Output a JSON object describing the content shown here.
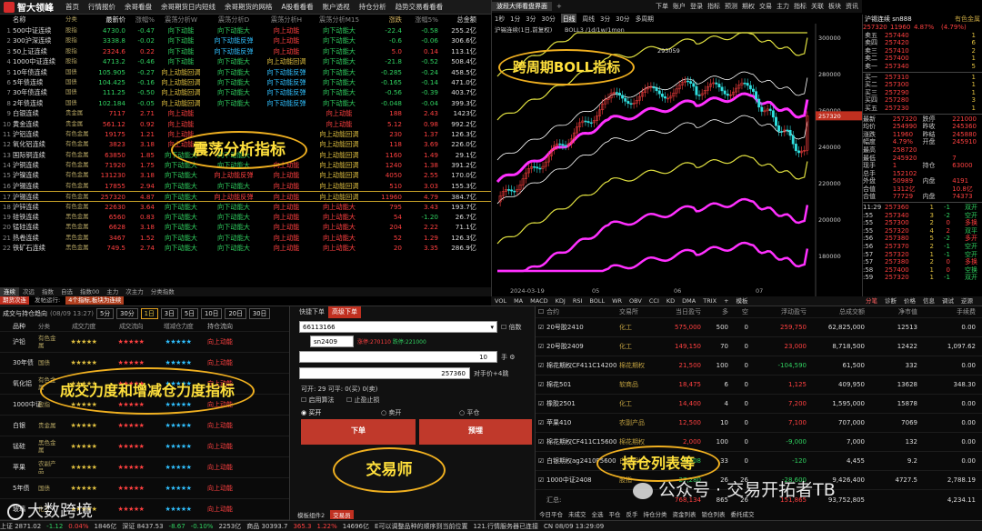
{
  "app": {
    "name": "智大领峰",
    "menu": [
      "首页",
      "行情报价",
      "余哥看盘",
      "余哥期货日内短线",
      "余哥期货的网格",
      "A股看看看",
      "账户透视",
      "持仓分析",
      "趋势交易看看看"
    ]
  },
  "quote": {
    "headers": [
      "名称",
      "分类",
      "最新价",
      "涨幅%",
      "震荡分析W",
      "震荡分析D",
      "震荡分析H",
      "震荡分析M15",
      "涨跌",
      "涨幅5%",
      "总金额"
    ],
    "rows": [
      {
        "n": "1",
        "name": "500中证连续",
        "cat": "股指",
        "price": "4730.0",
        "chg": "-0.47",
        "w": "向下动能",
        "d": "向下动能大",
        "h": "向上动能",
        "m": "向下动能大",
        "diff": "-22.4",
        "c5": "-0.58",
        "amt": "255.2亿",
        "dir": "down"
      },
      {
        "n": "2",
        "name": "300沪深连续",
        "cat": "股指",
        "price": "3338.8",
        "chg": "-0.02",
        "w": "向下动能",
        "d": "向下动能反弹",
        "h": "向上动能",
        "m": "向下动能大",
        "diff": "-0.6",
        "c5": "-0.06",
        "amt": "306.6亿",
        "dir": "down"
      },
      {
        "n": "3",
        "name": "50上证连续",
        "cat": "股指",
        "price": "2324.6",
        "chg": "0.22",
        "w": "向下动能",
        "d": "向下动能反弹",
        "h": "向上动能",
        "m": "向下动能大",
        "diff": "5.0",
        "c5": "0.14",
        "amt": "113.1亿",
        "dir": "up"
      },
      {
        "n": "4",
        "name": "1000中证连续",
        "cat": "股指",
        "price": "4713.2",
        "chg": "-0.46",
        "w": "向下动能",
        "d": "向下动能大",
        "h": "向上动能回调",
        "m": "向下动能大",
        "diff": "-21.8",
        "c5": "-0.52",
        "amt": "508.4亿",
        "dir": "down"
      },
      {
        "n": "5",
        "name": "10年债连续",
        "cat": "国债",
        "price": "105.905",
        "chg": "-0.27",
        "w": "向上动能回调",
        "d": "向下动能大",
        "h": "向下动能反弹",
        "m": "向下动能大",
        "diff": "-0.285",
        "c5": "-0.24",
        "amt": "458.5亿",
        "dir": "down"
      },
      {
        "n": "6",
        "name": "5年债连续",
        "cat": "国债",
        "price": "104.425",
        "chg": "-0.16",
        "w": "向上动能回调",
        "d": "向下动能大",
        "h": "向下动能反弹",
        "m": "向下动能大",
        "diff": "-0.165",
        "c5": "-0.14",
        "amt": "471.0亿",
        "dir": "down"
      },
      {
        "n": "7",
        "name": "30年债连续",
        "cat": "国债",
        "price": "111.25",
        "chg": "-0.50",
        "w": "向上动能回调",
        "d": "向下动能大",
        "h": "向下动能反弹",
        "m": "向下动能大",
        "diff": "-0.56",
        "c5": "-0.39",
        "amt": "403.7亿",
        "dir": "down"
      },
      {
        "n": "8",
        "name": "2年债连续",
        "cat": "国债",
        "price": "102.184",
        "chg": "-0.05",
        "w": "向上动能回调",
        "d": "向下动能大",
        "h": "向下动能反弹",
        "m": "向下动能大",
        "diff": "-0.048",
        "c5": "-0.04",
        "amt": "399.3亿",
        "dir": "down"
      },
      {
        "n": "9",
        "name": "白银连续",
        "cat": "贵金属",
        "price": "7117",
        "chg": "2.71",
        "w": "向上动能",
        "d": "",
        "h": "",
        "m": "向上动能",
        "diff": "188",
        "c5": "2.43",
        "amt": "1423亿",
        "dir": "up"
      },
      {
        "n": "10",
        "name": "黄金连续",
        "cat": "贵金属",
        "price": "561.12",
        "chg": "0.92",
        "w": "向上动能",
        "d": "",
        "h": "",
        "m": "向上动能",
        "diff": "5.12",
        "c5": "0.98",
        "amt": "992.2亿",
        "dir": "up"
      },
      {
        "n": "11",
        "name": "沪铝连续",
        "cat": "有色金属",
        "price": "19175",
        "chg": "1.21",
        "w": "向上动能",
        "d": "",
        "h": "",
        "m": "向上动能回调",
        "diff": "230",
        "c5": "1.37",
        "amt": "126.3亿",
        "dir": "up"
      },
      {
        "n": "12",
        "name": "氧化铝连续",
        "cat": "有色金属",
        "price": "3823",
        "chg": "3.18",
        "w": "向上动能",
        "d": "",
        "h": "",
        "m": "向上动能回调",
        "diff": "118",
        "c5": "3.69",
        "amt": "226.0亿",
        "dir": "up"
      },
      {
        "n": "13",
        "name": "国际铜连续",
        "cat": "有色金属",
        "price": "63850",
        "chg": "1.85",
        "w": "向下动能大",
        "d": "向下动能大",
        "h": "",
        "m": "向上动能回调",
        "diff": "1160",
        "c5": "1.49",
        "amt": "29.1亿",
        "dir": "up"
      },
      {
        "n": "14",
        "name": "沪铜连续",
        "cat": "有色金属",
        "price": "71920",
        "chg": "1.75",
        "w": "向下动能大",
        "d": "向下动能大",
        "h": "向上动能",
        "m": "向上动能回调",
        "diff": "1240",
        "c5": "1.38",
        "amt": "391.2亿",
        "dir": "up"
      },
      {
        "n": "15",
        "name": "沪镍连续",
        "cat": "有色金属",
        "price": "131230",
        "chg": "3.18",
        "w": "向下动能大",
        "d": "向上动能反弹",
        "h": "向上动能",
        "m": "向上动能回调",
        "diff": "4050",
        "c5": "2.55",
        "amt": "170.0亿",
        "dir": "up"
      },
      {
        "n": "16",
        "name": "沪锡连续",
        "cat": "有色金属",
        "price": "17855",
        "chg": "2.94",
        "w": "向下动能大",
        "d": "向下动能大",
        "h": "向上动能",
        "m": "向上动能回调",
        "diff": "510",
        "c5": "3.03",
        "amt": "155.3亿",
        "dir": "up"
      },
      {
        "n": "17",
        "name": "沪锡连续",
        "cat": "有色金属",
        "price": "257320",
        "chg": "4.87",
        "w": "向下动能大",
        "d": "向上动能反弹",
        "h": "向上动能",
        "m": "向上动能回调",
        "diff": "11960",
        "c5": "4.79",
        "amt": "384.7亿",
        "dir": "up"
      },
      {
        "n": "18",
        "name": "沪锌连续",
        "cat": "有色金属",
        "price": "22630",
        "chg": "3.64",
        "w": "向下动能大",
        "d": "向下动能大",
        "h": "向上动能",
        "m": "向上动能大",
        "diff": "795",
        "c5": "3.43",
        "amt": "193.7亿",
        "dir": "up"
      },
      {
        "n": "19",
        "name": "硅铁连续",
        "cat": "黑色金属",
        "price": "6560",
        "chg": "0.83",
        "w": "向下动能大",
        "d": "向下动能大",
        "h": "向上动能",
        "m": "向上动能大",
        "diff": "54",
        "c5": "-1.20",
        "amt": "26.7亿",
        "dir": "up"
      },
      {
        "n": "20",
        "name": "锰硅连续",
        "cat": "黑色金属",
        "price": "6628",
        "chg": "3.18",
        "w": "向下动能大",
        "d": "向下动能大",
        "h": "向上动能",
        "m": "向上动能大",
        "diff": "204",
        "c5": "2.22",
        "amt": "71.1亿",
        "dir": "up"
      },
      {
        "n": "21",
        "name": "热卷连续",
        "cat": "黑色金属",
        "price": "3467",
        "chg": "1.52",
        "w": "向下动能大",
        "d": "向下动能大",
        "h": "向上动能",
        "m": "向上动能大",
        "diff": "52",
        "c5": "1.29",
        "amt": "126.3亿",
        "dir": "up"
      },
      {
        "n": "22",
        "name": "铁矿石连续",
        "cat": "黑色金属",
        "price": "749.5",
        "chg": "2.74",
        "w": "向下动能大",
        "d": "向下动能大",
        "h": "向上动能",
        "m": "向上动能大",
        "diff": "20",
        "c5": "3.35",
        "amt": "286.9亿",
        "dir": "up"
      }
    ],
    "tabs": [
      "连续",
      "次远",
      "指数",
      "自选",
      "指数00",
      "主力",
      "次主力",
      "分类指数"
    ],
    "status": {
      "badge1": "期货次连",
      "mid": "发帖运行:",
      "badge2": "4个指标,板块为连续"
    }
  },
  "chart": {
    "title": "波段大师看盘界面",
    "toolbar": [
      "下单",
      "账户",
      "登录",
      "指标",
      "预测",
      "期权",
      "交易",
      "主力",
      "指标",
      "关联",
      "板块",
      "资讯"
    ],
    "periods": [
      "1秒",
      "1分",
      "3分",
      "30分",
      "日线",
      "周线",
      "3分",
      "30分",
      "多周期"
    ],
    "active_period": "日线",
    "legend": "沪锡连续(1日,前复权)",
    "boll_label": "BOLL3 /1d/1w/1mon",
    "high_label": "293059",
    "axis_labels": [
      "300000",
      "280000",
      "260000",
      "240000",
      "220000",
      "200000",
      "180000"
    ],
    "date_labels": [
      "2024-03-19",
      "05",
      "06",
      "07"
    ],
    "indicators": [
      "VOL",
      "MA",
      "MACD",
      "KDJ",
      "RSI",
      "BOLL",
      "WR",
      "OBV",
      "CCI",
      "KD",
      "DMA",
      "TRIX",
      "+",
      "模板"
    ]
  },
  "order_book": {
    "title": "沪锡连续 sn888",
    "title_right": "有色金属",
    "quote_line": {
      "price": "257320",
      "chg": "11960",
      "pct": "4.87%",
      "pct2": "(4.79%)"
    },
    "asks": [
      [
        "卖五",
        "257440",
        "1"
      ],
      [
        "卖四",
        "257420",
        "6"
      ],
      [
        "卖三",
        "257410",
        "2"
      ],
      [
        "卖二",
        "257400",
        "1"
      ],
      [
        "卖一",
        "257340",
        "5"
      ]
    ],
    "bids": [
      [
        "买一",
        "257310",
        "1"
      ],
      [
        "买二",
        "257300",
        "1"
      ],
      [
        "买三",
        "257290",
        "1"
      ],
      [
        "买四",
        "257280",
        "3"
      ],
      [
        "买五",
        "257230",
        "1"
      ]
    ],
    "stats": [
      [
        "最新",
        "257320",
        "跌停",
        "221000"
      ],
      [
        "均价",
        "254990",
        "昨收",
        "245360"
      ],
      [
        "涨跌",
        "11960",
        "昨结",
        "245880"
      ],
      [
        "幅度",
        "4.79%",
        "开盘",
        "245910"
      ],
      [
        "最高",
        "258720",
        "",
        ""
      ],
      [
        "最低",
        "245920",
        "",
        "7"
      ],
      [
        "现手",
        "1",
        "持仓",
        "63000"
      ],
      [
        "总手",
        "152102",
        "",
        ""
      ],
      [
        "外盘",
        "50989",
        "内盘",
        "4191"
      ],
      [
        "合值",
        "1312亿",
        "",
        "10.8亿"
      ],
      [
        "合值",
        "77729",
        "内盘",
        "74373"
      ]
    ],
    "ticks": [
      [
        "11:29",
        "257360",
        "1",
        "-1",
        "双开"
      ],
      [
        ":55",
        "257340",
        "3",
        "-2",
        "空开"
      ],
      [
        ":55",
        "257300",
        "2",
        "0",
        "多换"
      ],
      [
        ":55",
        "257320",
        "4",
        "2",
        "双平"
      ],
      [
        ":56",
        "257380",
        "5",
        "-2",
        "多开"
      ],
      [
        ":56",
        "257370",
        "2",
        "-1",
        "空开"
      ],
      [
        ":57",
        "257320",
        "1",
        "-1",
        "空开"
      ],
      [
        ":57",
        "257380",
        "2",
        "0",
        "多换"
      ],
      [
        ":58",
        "257400",
        "1",
        "0",
        "空换"
      ],
      [
        ":59",
        "257320",
        "1",
        "-1",
        "双开"
      ]
    ],
    "tabs": [
      "分笔",
      "诊断",
      "价格",
      "信息",
      "调试",
      "逆源"
    ]
  },
  "ranking": {
    "title": "成交与持仓趋向",
    "date": "(08/09 13:27)",
    "periods": [
      "5分",
      "30分",
      "1日",
      "3日",
      "5日",
      "10日",
      "20日",
      "30日"
    ],
    "active": "1日",
    "headers": [
      "品种",
      "分类",
      "成交力度",
      "成交流向",
      "增减仓力度",
      "持仓流向"
    ],
    "rows": [
      {
        "name": "沪铅",
        "cat": "有色金属",
        "a": "★★★★★",
        "b": "★★★★★",
        "c": "★★★★★",
        "d": "向上动能"
      },
      {
        "name": "30年债",
        "cat": "国债",
        "a": "★★★★★",
        "b": "★★★★★",
        "c": "★★★★★",
        "d": "向上动能"
      },
      {
        "name": "氧化铝",
        "cat": "有色金属",
        "a": "★★★★★",
        "b": "★★★★★",
        "c": "★★★★★",
        "d": "向上动能"
      },
      {
        "name": "1000中证",
        "cat": "股指",
        "a": "★★★★★",
        "b": "★★★★★",
        "c": "★★★★★",
        "d": "向上动能"
      },
      {
        "name": "白银",
        "cat": "贵金属",
        "a": "★★★★★",
        "b": "★★★★★",
        "c": "★★★★★",
        "d": "向上动能"
      },
      {
        "name": "锰硅",
        "cat": "黑色金属",
        "a": "★★★★★",
        "b": "★★★★★",
        "c": "★★★★★",
        "d": "向上动能"
      },
      {
        "name": "苹果",
        "cat": "农副产品",
        "a": "★★★★★",
        "b": "★★★★★",
        "c": "★★★★★",
        "d": "向上动能"
      },
      {
        "name": "5年债",
        "cat": "国债",
        "a": "★★★★★",
        "b": "★★★★★",
        "c": "★★★★★",
        "d": "向上动能"
      },
      {
        "name": "玻璃",
        "cat": "化工",
        "a": "★★★★★",
        "b": "★★★★★",
        "c": "★★★★★",
        "d": "向上动能"
      }
    ]
  },
  "trade": {
    "tabs": [
      "快捷下单",
      "高级下单"
    ],
    "account": "66113166",
    "contract": "sn2409",
    "limit_up": "涨停:270110",
    "limit_down": "跌停:221000",
    "qty_label": "数量",
    "qty": "10",
    "price": "257360",
    "options": [
      "对手价+4跳"
    ],
    "avail": "可开: 29  可平: 0(买)  0(卖)",
    "checks": [
      "启用算法",
      "止盈止损"
    ],
    "sides": [
      "买开",
      "卖开",
      "平仓"
    ],
    "buy_label": "下单",
    "preview_label": "预埋",
    "bottom_tabs": [
      "模板组件2",
      "交易员"
    ]
  },
  "positions": {
    "headers": [
      "合约",
      "交易所",
      "当日盈亏",
      "多",
      "空",
      "浮动盈亏",
      "总成交额",
      "净市值",
      "手续费"
    ],
    "rows": [
      {
        "name": "20号胶2410",
        "exch": "化工",
        "pnl": "575,000",
        "long": "500",
        "short": "0",
        "float": "259,750",
        "turnover": "62,825,000",
        "nv": "12513",
        "fee": "0.00"
      },
      {
        "name": "20号胶2409",
        "exch": "化工",
        "pnl": "149,150",
        "long": "70",
        "short": "0",
        "float": "23,000",
        "turnover": "8,718,500",
        "nv": "12422",
        "fee": "1,097.62"
      },
      {
        "name": "棉花期权CF411C14200",
        "exch": "棉花期权",
        "pnl": "21,500",
        "long": "100",
        "short": "0",
        "float": "-104,590",
        "turnover": "61,500",
        "nv": "332",
        "fee": "0.00"
      },
      {
        "name": "棉花501",
        "exch": "软商品",
        "pnl": "18,475",
        "long": "6",
        "short": "0",
        "float": "1,125",
        "turnover": "409,950",
        "nv": "13628",
        "fee": "348.30"
      },
      {
        "name": "橡胶2501",
        "exch": "化工",
        "pnl": "14,400",
        "long": "4",
        "short": "0",
        "float": "7,200",
        "turnover": "1,595,000",
        "nv": "15878",
        "fee": "0.00"
      },
      {
        "name": "苹果410",
        "exch": "农副产品",
        "pnl": "12,500",
        "long": "10",
        "short": "0",
        "float": "7,100",
        "turnover": "707,000",
        "nv": "7069",
        "fee": "0.00"
      },
      {
        "name": "棉花期权CF411C15600",
        "exch": "棉花期权",
        "pnl": "2,000",
        "long": "100",
        "short": "0",
        "float": "-9,000",
        "turnover": "7,000",
        "nv": "132",
        "fee": "0.00"
      },
      {
        "name": "白银期权ag2410P5600",
        "exch": "白银期权",
        "pnl": "-4,208",
        "long": "33",
        "short": "0",
        "float": "-120",
        "turnover": "4,455",
        "nv": "9.2",
        "fee": "0.00"
      },
      {
        "name": "1000中证2408",
        "exch": "股指",
        "pnl": "-27,280",
        "long": "26",
        "short": "26",
        "float": "-28,600",
        "turnover": "9,426,400",
        "nv": "4727.5",
        "fee": "2,788.19"
      }
    ],
    "summary": {
      "label": "汇总:",
      "pnl": "768,134",
      "long": "865",
      "short": "26",
      "float": "151,865",
      "turnover": "93,752,805",
      "fee": "4,234.11"
    },
    "bottom_tabs": [
      "今日平仓",
      "未成交",
      "全选",
      "平仓",
      "反手",
      "持仓分类",
      "资金列表",
      "锁仓列表",
      "委托成交"
    ]
  },
  "statusbar": {
    "items": [
      "上证 2871.02",
      "-1.12",
      "0.04%",
      "1846亿",
      "深证 8437.53",
      "-8.67",
      "-0.10%",
      "2253亿",
      "商品 30393.7",
      "365.3",
      "1.22%",
      "14696亿",
      "E可以调整品种的顺序到当前位置",
      "121.行情服务器已连接",
      "CN 08/09 13:29:09"
    ]
  },
  "annotations": {
    "zhendang": "震荡分析指标",
    "boll": "跨周期BOLL指标",
    "chengjiao": "成交力度和增减仓力度指标",
    "trader": "交易师",
    "poslist": "持仓列表等",
    "wm_brand": "大数跨境",
    "wm_public": "公众号 · 交易开拓者TB"
  }
}
